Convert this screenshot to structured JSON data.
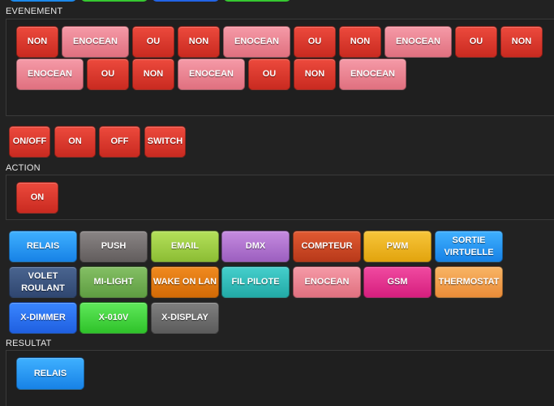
{
  "sections": {
    "evenement": "EVENEMENT",
    "action": "ACTION",
    "resultat": "RESULTAT"
  },
  "evenement_buttons": [
    "NON",
    "ENOCEAN",
    "OU",
    "NON",
    "ENOCEAN",
    "OU",
    "NON",
    "ENOCEAN",
    "OU",
    "NON",
    "ENOCEAN",
    "OU",
    "NON",
    "ENOCEAN",
    "OU",
    "NON",
    "ENOCEAN"
  ],
  "action_buttons": [
    "ON/OFF",
    "ON",
    "OFF",
    "SWITCH"
  ],
  "action_selected": "ON",
  "resultat_buttons": [
    "RELAIS",
    "PUSH",
    "EMAIL",
    "DMX",
    "COMPTEUR",
    "PWM",
    "SORTIE VIRTUELLE",
    "VOLET ROULANT",
    "MI-LIGHT",
    "WAKE ON LAN",
    "FIL PILOTE",
    "ENOCEAN",
    "GSM",
    "THERMOSTAT",
    "X-DIMMER",
    "X-010V",
    "X-DISPLAY"
  ],
  "resultat_selected": "RELAIS",
  "colors": {
    "background": "#222222",
    "red": "#d9362b",
    "pink": "#ea8595",
    "relais_blue": "#1f8ff2"
  }
}
